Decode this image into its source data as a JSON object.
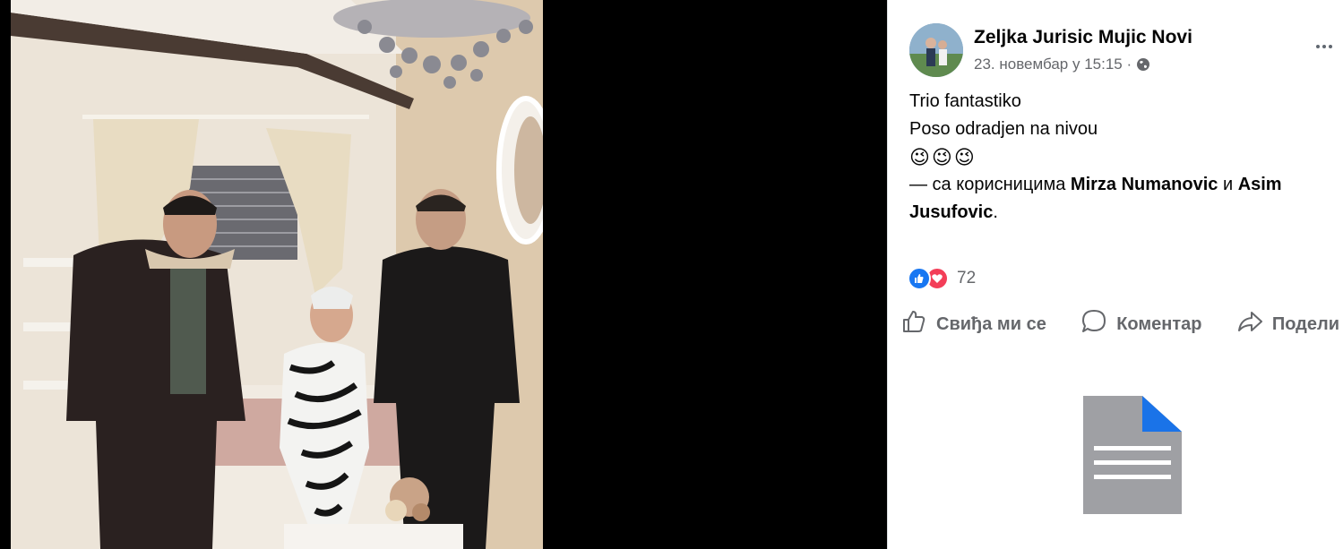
{
  "post": {
    "author": "Zeljka Jurisic Mujic Novi",
    "timestamp": "23. новембар у 15:15 ·",
    "text_lines": [
      "Trio fantastiko",
      "Poso odradjen na nivou"
    ],
    "emojis": "😉😉😉",
    "tag_prefix": "— са корисницима ",
    "tag_user1": "Mirza Numanovic",
    "tag_and": " и ",
    "tag_user2": "Asim Jusufovic",
    "tag_suffix": "."
  },
  "reactions": {
    "count": "72",
    "types": [
      "like",
      "love"
    ]
  },
  "actions": {
    "like": "Свиђа ми се",
    "comment": "Коментар",
    "share": "Подели"
  },
  "icons": {
    "privacy": "globe-icon",
    "menu": "more-options-icon",
    "placeholder": "document-icon"
  },
  "colors": {
    "like_blue": "#1877f2",
    "love_red": "#f33e58",
    "secondary_text": "#65676b"
  }
}
